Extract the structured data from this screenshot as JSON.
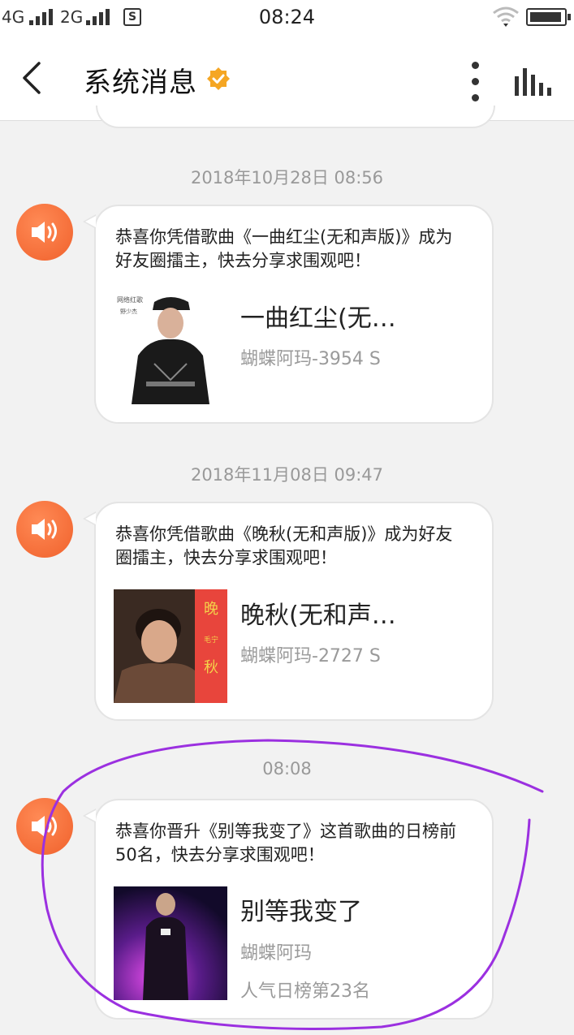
{
  "status_bar": {
    "network_1": "4G",
    "network_2": "2G",
    "sim_icon": "S",
    "time": "08:24"
  },
  "header": {
    "title": "系统消息"
  },
  "messages": [
    {
      "timestamp": "2018年10月28日 08:56",
      "text": "恭喜你凭借歌曲《一曲红尘(无和声版)》成为好友圈擂主，快去分享求围观吧！",
      "song_title": "一曲红尘(无…",
      "song_meta": "蝴蝶阿玛-3954 S",
      "cover_text": [
        "网络红歌",
        "野少杰"
      ]
    },
    {
      "timestamp": "2018年11月08日 09:47",
      "text": "恭喜你凭借歌曲《晚秋(无和声版)》成为好友圈擂主，快去分享求围观吧！",
      "song_title": "晚秋(无和声…",
      "song_meta": "蝴蝶阿玛-2727 S",
      "cover_text": [
        "晚",
        "毛宁",
        "秋"
      ]
    },
    {
      "timestamp": "08:08",
      "text": "恭喜你晋升《别等我变了》这首歌曲的日榜前50名，快去分享求围观吧！",
      "song_title": "别等我变了",
      "song_meta": "蝴蝶阿玛",
      "song_rank": "人气日榜第23名"
    }
  ],
  "colors": {
    "avatar": "#f0612c",
    "verified_badge": "#f5a623",
    "annotation": "#9b30e0"
  }
}
